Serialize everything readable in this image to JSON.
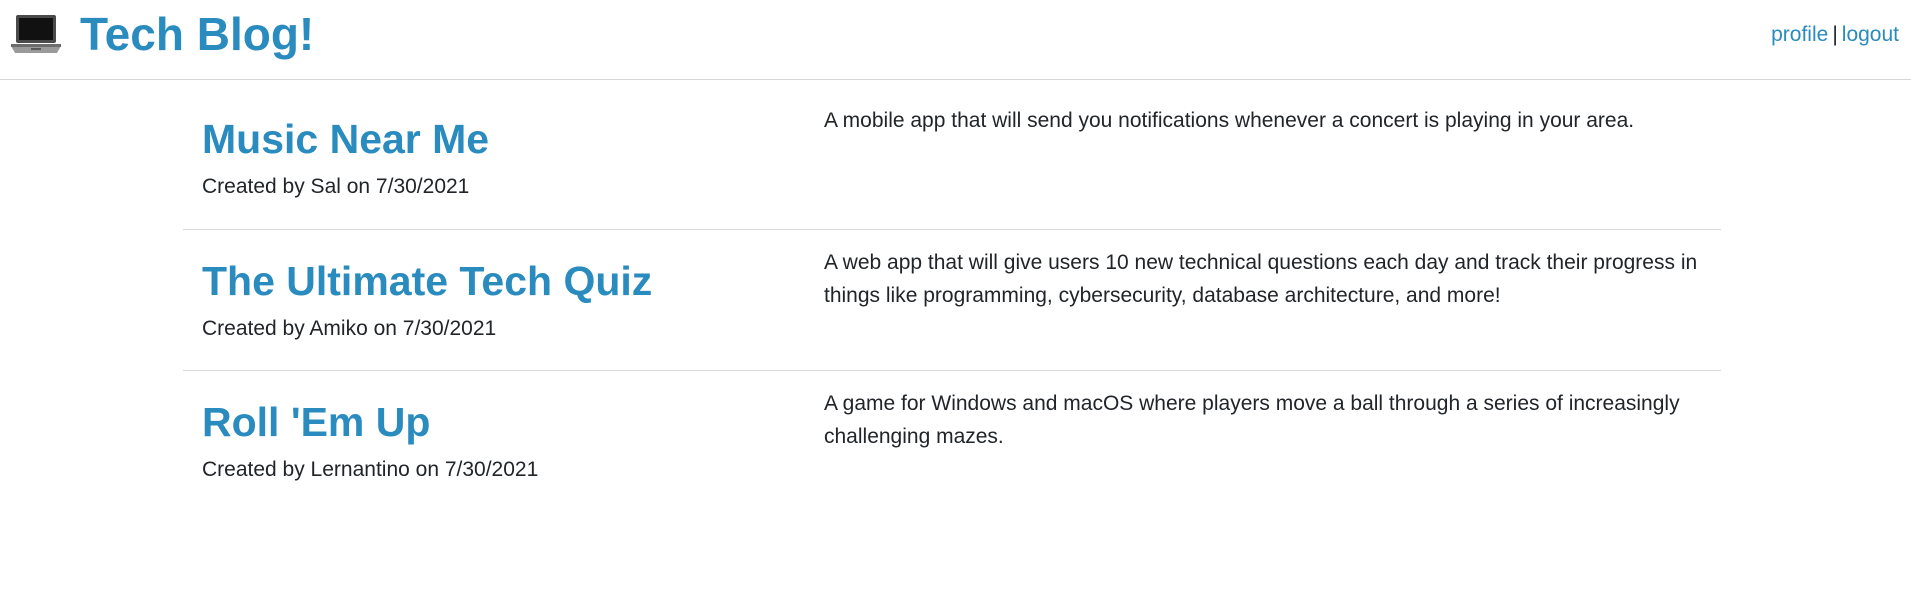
{
  "header": {
    "title": "Tech Blog!",
    "icon": "laptop-icon",
    "nav": {
      "profile_label": "profile",
      "separator": "|",
      "logout_label": "logout"
    }
  },
  "posts": [
    {
      "title": "Music Near Me",
      "meta": "Created by Sal on 7/30/2021",
      "description": "A mobile app that will send you notifications whenever a concert is playing in your area."
    },
    {
      "title": "The Ultimate Tech Quiz",
      "meta": "Created by Amiko on 7/30/2021",
      "description": "A web app that will give users 10 new technical questions each day and track their progress in things like programming, cybersecurity, database architecture, and more!"
    },
    {
      "title": "Roll 'Em Up",
      "meta": "Created by Lernantino on 7/30/2021",
      "description": "A game for Windows and macOS where players move a ball through a series of increasingly challenging mazes."
    }
  ],
  "colors": {
    "accent": "#2a8bbf",
    "text": "#212529",
    "divider": "#d9d9d9"
  }
}
